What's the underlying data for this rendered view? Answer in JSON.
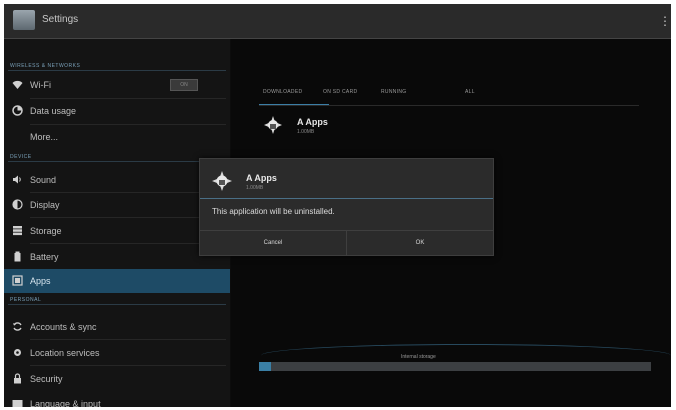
{
  "titlebar": {
    "title": "Settings",
    "app_icon": "settings-icon",
    "overflow_icon": "overflow-menu-icon"
  },
  "sidebar": {
    "sections": {
      "wireless": "WIRELESS & NETWORKS",
      "device": "DEVICE",
      "personal": "PERSONAL"
    },
    "items": [
      {
        "label": "Wi-Fi",
        "icon": "wifi-icon",
        "toggle": "ON"
      },
      {
        "label": "Data usage",
        "icon": "data-usage-icon"
      },
      {
        "label": "More...",
        "icon": ""
      },
      {
        "label": "Sound",
        "icon": "sound-icon"
      },
      {
        "label": "Display",
        "icon": "display-icon"
      },
      {
        "label": "Storage",
        "icon": "storage-icon"
      },
      {
        "label": "Battery",
        "icon": "battery-icon"
      },
      {
        "label": "Apps",
        "icon": "apps-icon",
        "selected": true
      },
      {
        "label": "Accounts & sync",
        "icon": "sync-icon"
      },
      {
        "label": "Location services",
        "icon": "location-icon"
      },
      {
        "label": "Security",
        "icon": "lock-icon"
      },
      {
        "label": "Language & input",
        "icon": "keyboard-icon"
      }
    ]
  },
  "main": {
    "tabs": [
      {
        "label": "DOWNLOADED"
      },
      {
        "label": "ON SD CARD"
      },
      {
        "label": "RUNNING"
      },
      {
        "label": "ALL"
      }
    ],
    "app_row": {
      "name": "A Apps",
      "size": "1.00MB",
      "icon": "android-icon"
    },
    "storage": {
      "label": "Internal storage",
      "used_fraction": 0.03
    }
  },
  "dialog": {
    "title": "A Apps",
    "subtitle": "1.00MB",
    "message": "This application will be uninstalled.",
    "cancel_label": "Cancel",
    "ok_label": "OK"
  },
  "colors": {
    "accent": "#3b7ea6",
    "selected_bg": "#1e4b66",
    "background": "#0c0c0c"
  }
}
